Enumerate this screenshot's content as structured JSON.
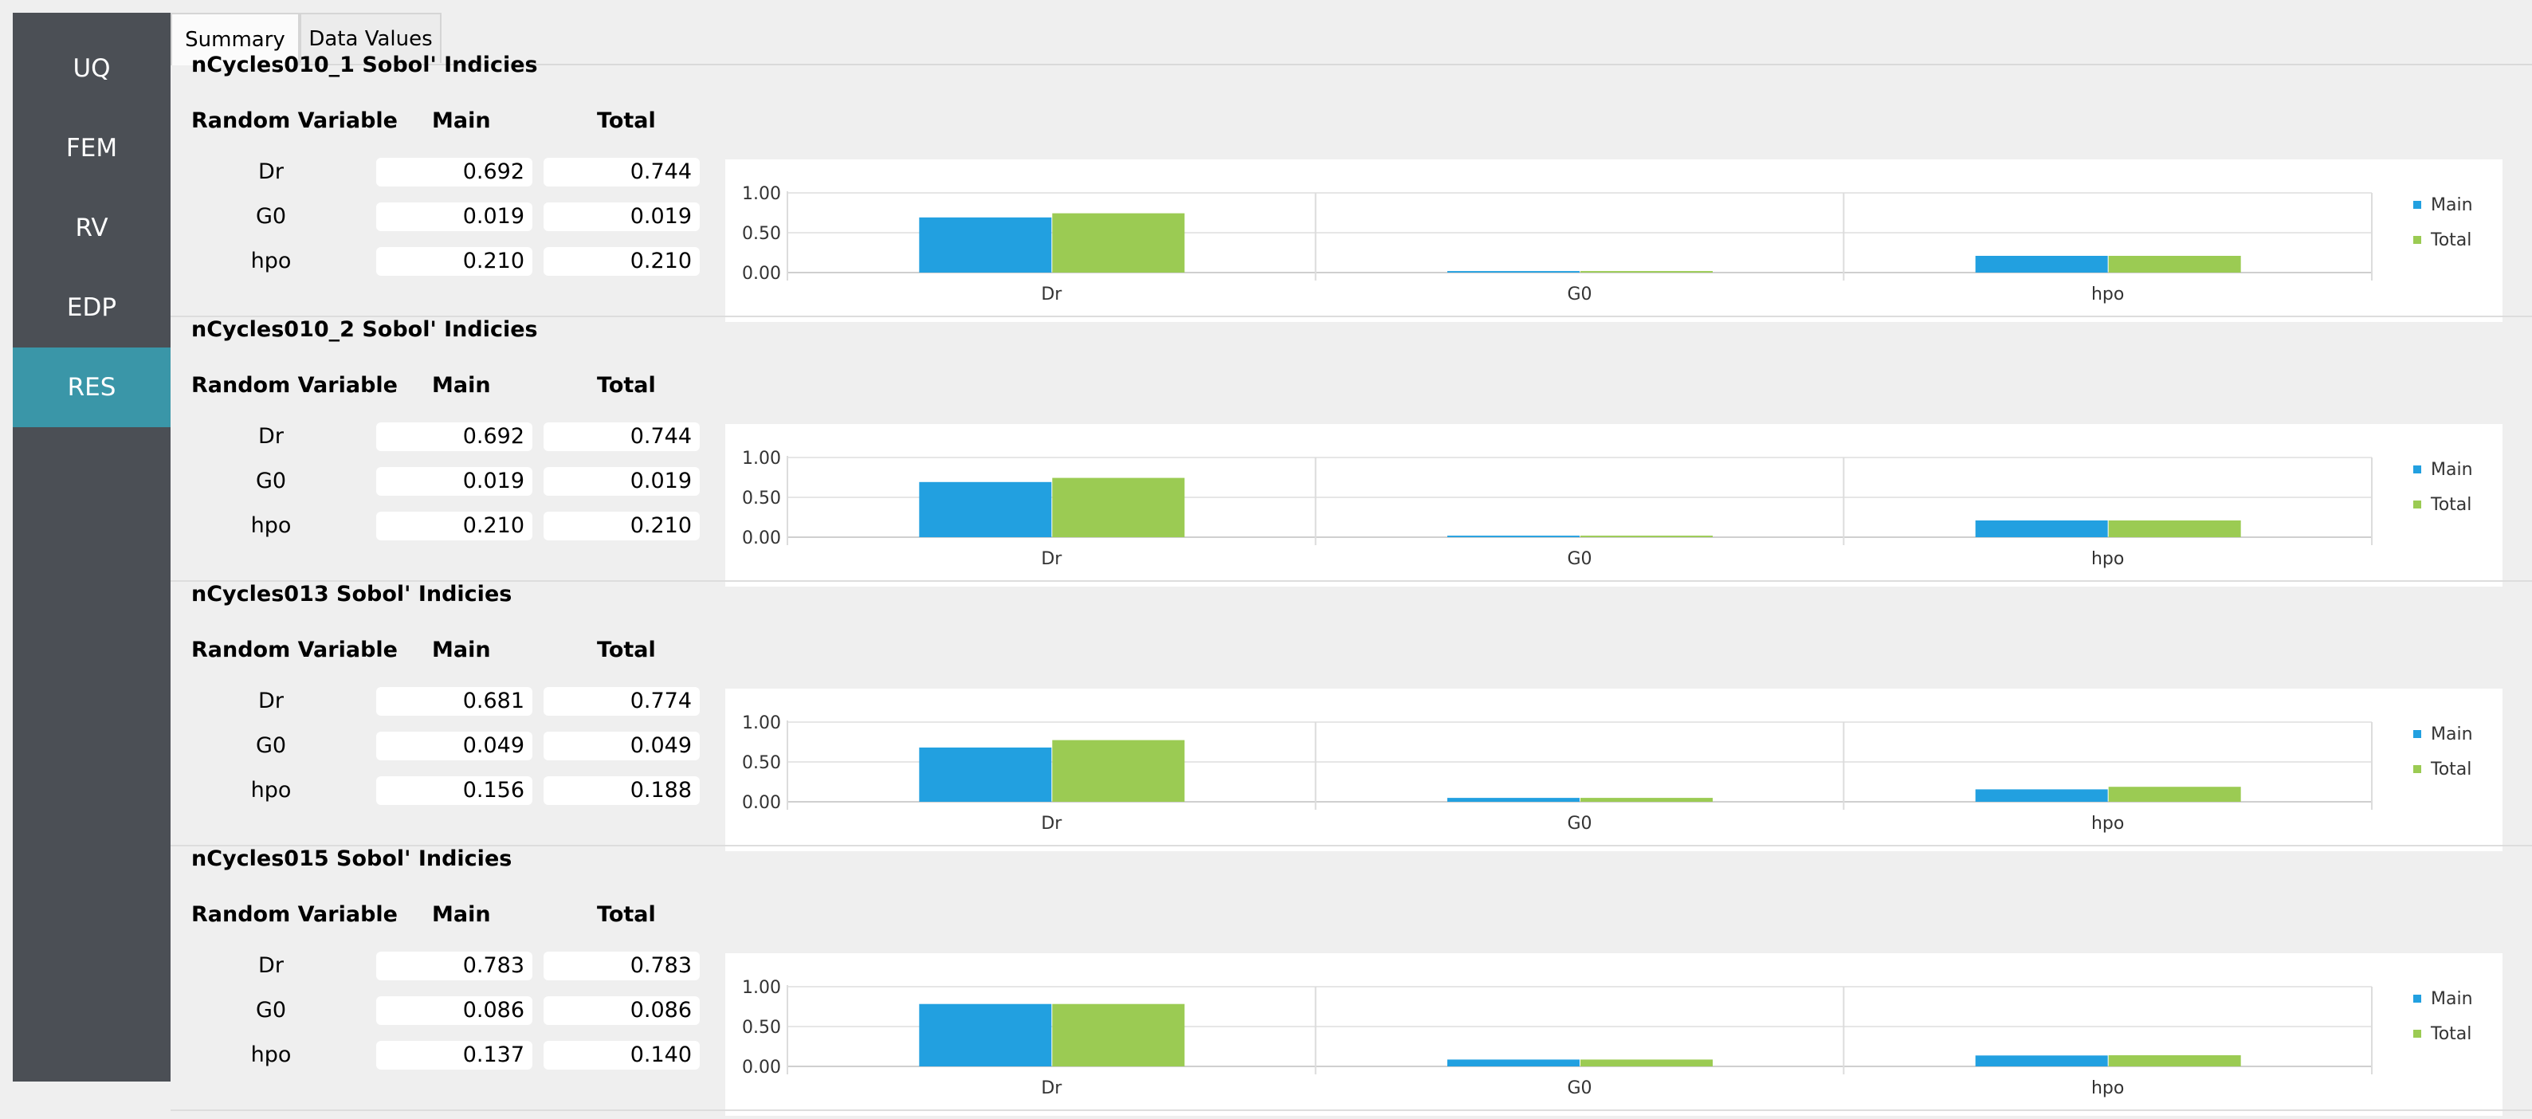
{
  "sidebar": {
    "items": [
      {
        "label": "UQ",
        "active": false
      },
      {
        "label": "FEM",
        "active": false
      },
      {
        "label": "RV",
        "active": false
      },
      {
        "label": "EDP",
        "active": false
      },
      {
        "label": "RES",
        "active": true
      }
    ]
  },
  "tabs": [
    {
      "label": "Summary",
      "active": true
    },
    {
      "label": "Data Values",
      "active": false
    }
  ],
  "table_headers": {
    "rv": "Random Variable",
    "main": "Main",
    "total": "Total"
  },
  "colors": {
    "main": "#22a0e0",
    "total": "#9bcb53",
    "sidebar_bg": "#4b4f55",
    "sidebar_active": "#3a96a8"
  },
  "sections": [
    {
      "title": "nCycles010_1 Sobol' Indicies",
      "rows": [
        {
          "name": "Dr",
          "main": "0.692",
          "total": "0.744"
        },
        {
          "name": "G0",
          "main": "0.019",
          "total": "0.019"
        },
        {
          "name": "hpo",
          "main": "0.210",
          "total": "0.210"
        }
      ]
    },
    {
      "title": "nCycles010_2 Sobol' Indicies",
      "rows": [
        {
          "name": "Dr",
          "main": "0.692",
          "total": "0.744"
        },
        {
          "name": "G0",
          "main": "0.019",
          "total": "0.019"
        },
        {
          "name": "hpo",
          "main": "0.210",
          "total": "0.210"
        }
      ]
    },
    {
      "title": "nCycles013 Sobol' Indicies",
      "rows": [
        {
          "name": "Dr",
          "main": "0.681",
          "total": "0.774"
        },
        {
          "name": "G0",
          "main": "0.049",
          "total": "0.049"
        },
        {
          "name": "hpo",
          "main": "0.156",
          "total": "0.188"
        }
      ]
    },
    {
      "title": "nCycles015 Sobol' Indicies",
      "rows": [
        {
          "name": "Dr",
          "main": "0.783",
          "total": "0.783"
        },
        {
          "name": "G0",
          "main": "0.086",
          "total": "0.086"
        },
        {
          "name": "hpo",
          "main": "0.137",
          "total": "0.140"
        }
      ]
    }
  ],
  "chart_data": [
    {
      "type": "bar",
      "title": "",
      "xlabel": "",
      "ylabel": "",
      "categories": [
        "Dr",
        "G0",
        "hpo"
      ],
      "series": [
        {
          "name": "Main",
          "values": [
            0.692,
            0.019,
            0.21
          ]
        },
        {
          "name": "Total",
          "values": [
            0.744,
            0.019,
            0.21
          ]
        }
      ],
      "ylim": [
        0,
        1.0
      ],
      "yticks": [
        "0.00",
        "0.50",
        "1.00"
      ],
      "grid": true,
      "legend": "right"
    },
    {
      "type": "bar",
      "title": "",
      "xlabel": "",
      "ylabel": "",
      "categories": [
        "Dr",
        "G0",
        "hpo"
      ],
      "series": [
        {
          "name": "Main",
          "values": [
            0.692,
            0.019,
            0.21
          ]
        },
        {
          "name": "Total",
          "values": [
            0.744,
            0.019,
            0.21
          ]
        }
      ],
      "ylim": [
        0,
        1.0
      ],
      "yticks": [
        "0.00",
        "0.50",
        "1.00"
      ],
      "grid": true,
      "legend": "right"
    },
    {
      "type": "bar",
      "title": "",
      "xlabel": "",
      "ylabel": "",
      "categories": [
        "Dr",
        "G0",
        "hpo"
      ],
      "series": [
        {
          "name": "Main",
          "values": [
            0.681,
            0.049,
            0.156
          ]
        },
        {
          "name": "Total",
          "values": [
            0.774,
            0.049,
            0.188
          ]
        }
      ],
      "ylim": [
        0,
        1.0
      ],
      "yticks": [
        "0.00",
        "0.50",
        "1.00"
      ],
      "grid": true,
      "legend": "right"
    },
    {
      "type": "bar",
      "title": "",
      "xlabel": "",
      "ylabel": "",
      "categories": [
        "Dr",
        "G0",
        "hpo"
      ],
      "series": [
        {
          "name": "Main",
          "values": [
            0.783,
            0.086,
            0.137
          ]
        },
        {
          "name": "Total",
          "values": [
            0.783,
            0.086,
            0.14
          ]
        }
      ],
      "ylim": [
        0,
        1.0
      ],
      "yticks": [
        "0.00",
        "0.50",
        "1.00"
      ],
      "grid": true,
      "legend": "right"
    }
  ]
}
